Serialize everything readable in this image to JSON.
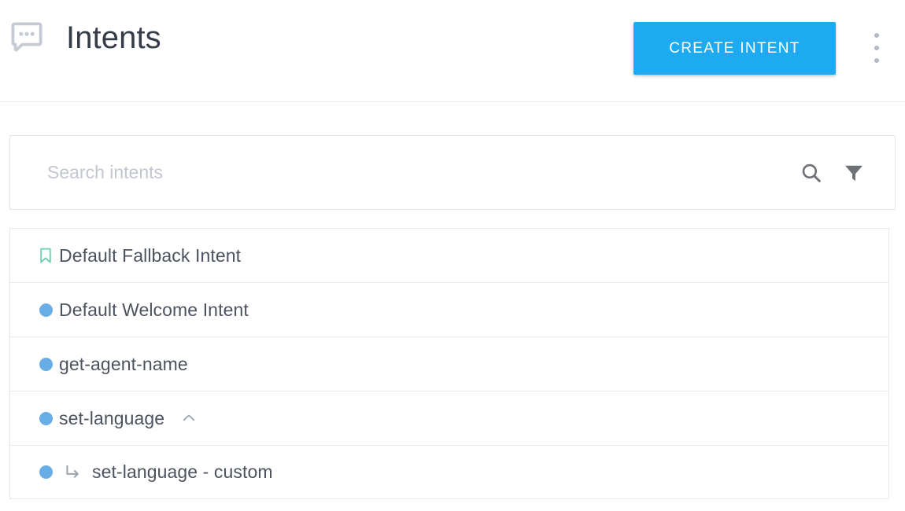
{
  "header": {
    "title": "Intents",
    "agent_icon": "chat-bubble-icon",
    "create_button_label": "CREATE INTENT",
    "overflow_menu_icon": "more-vert-icon",
    "accent_color": "#1eaaf1",
    "title_color": "#353c48",
    "agent_icon_color": "#c5cad4"
  },
  "search": {
    "placeholder": "Search intents",
    "value": "",
    "search_icon": "search-icon",
    "filter_icon": "filter-icon",
    "icon_color": "#6e7176"
  },
  "list": {
    "rows": [
      {
        "label": "Default Fallback Intent",
        "marker": "bookmark-icon",
        "marker_color": "#6ed0b1",
        "is_child": false,
        "has_toggle": false,
        "toggle_icon": ""
      },
      {
        "label": "Default Welcome Intent",
        "marker": "status-dot",
        "marker_color": "#69ade7",
        "is_child": false,
        "has_toggle": false,
        "toggle_icon": ""
      },
      {
        "label": "get-agent-name",
        "marker": "status-dot",
        "marker_color": "#69ade7",
        "is_child": false,
        "has_toggle": false,
        "toggle_icon": ""
      },
      {
        "label": "set-language",
        "marker": "status-dot",
        "marker_color": "#69ade7",
        "is_child": false,
        "has_toggle": true,
        "toggle_icon": "chevron-up-icon"
      },
      {
        "label": "set-language - custom",
        "marker": "status-dot",
        "marker_color": "#69ade7",
        "is_child": true,
        "has_toggle": false,
        "toggle_icon": "subdirectory-arrow-right-icon"
      }
    ]
  }
}
